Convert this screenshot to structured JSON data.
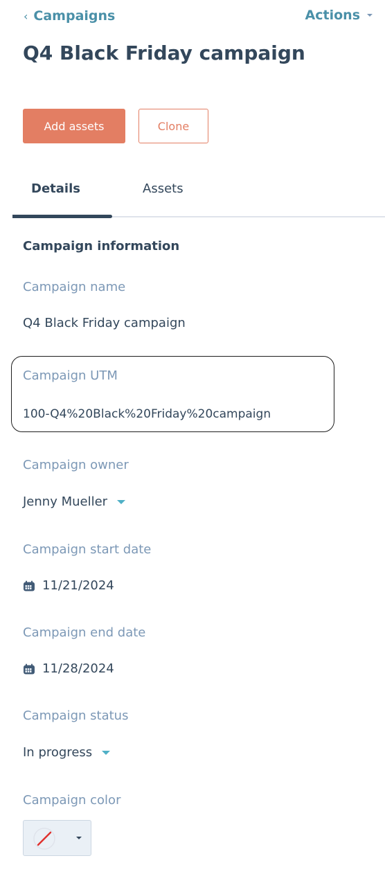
{
  "header": {
    "back_label": "Campaigns",
    "actions_label": "Actions",
    "title": "Q4 Black Friday campaign"
  },
  "buttons": {
    "add_assets": "Add assets",
    "clone": "Clone"
  },
  "tabs": [
    {
      "label": "Details",
      "active": true
    },
    {
      "label": "Assets",
      "active": false
    }
  ],
  "section": {
    "title": "Campaign information"
  },
  "fields": {
    "name": {
      "label": "Campaign name",
      "value": "Q4 Black Friday campaign"
    },
    "utm": {
      "label": "Campaign UTM",
      "value": "100-Q4%20Black%20Friday%20campaign"
    },
    "owner": {
      "label": "Campaign owner",
      "value": "Jenny Mueller"
    },
    "start_date": {
      "label": "Campaign start date",
      "value": "11/21/2024"
    },
    "end_date": {
      "label": "Campaign end date",
      "value": "11/28/2024"
    },
    "status": {
      "label": "Campaign status",
      "value": "In progress"
    },
    "color": {
      "label": "Campaign color",
      "value": "none"
    }
  },
  "colors": {
    "primary": "#e37e63",
    "link": "#4a90a8",
    "text": "#33475b",
    "label": "#7c98b6",
    "caret": "#4fb0c6"
  }
}
